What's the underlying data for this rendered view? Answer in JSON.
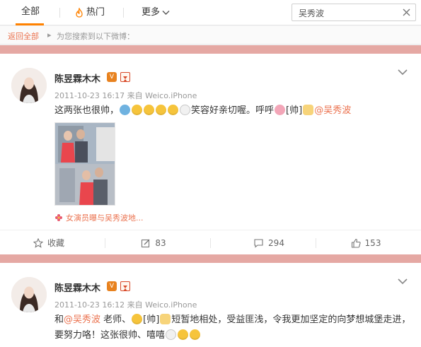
{
  "tabs": {
    "all": "全部",
    "hot": "热门",
    "more": "更多"
  },
  "search": {
    "value": "吴秀波"
  },
  "breadcrumb": {
    "back": "返回全部",
    "separator": "▸",
    "hint": "为您搜索到以下微博："
  },
  "icons": {
    "hot": "flame-icon",
    "more": "chevron-down-icon",
    "clear": "close-icon",
    "collapse": "chevron-down-icon",
    "star": "star-icon",
    "edit": "edit-icon",
    "comment": "comment-icon",
    "like": "thumbs-up-icon"
  },
  "colors": {
    "accent": "#ff8200",
    "link": "#eb7350",
    "separator": "#e5a8a3"
  },
  "posts": [
    {
      "username": "陈昱霖木木",
      "time": "2011-10-23 16:17",
      "source_prefix": "来自",
      "source": "Weico.iPhone",
      "text_a": "这两张也很帅，",
      "text_b": "笑容好亲切喔。呼呼",
      "tag": "[帅]",
      "mention": "@吴秀波",
      "topic": "女演员曝与吴秀波地...",
      "actions": {
        "favorite": "收藏",
        "repost": "83",
        "comment": "294",
        "like": "153"
      }
    },
    {
      "username": "陈昱霖木木",
      "time": "2011-10-23 16:12",
      "source_prefix": "来自",
      "source": "Weico.iPhone",
      "text_pre": "和",
      "mention": "@吴秀波",
      "text_a": " 老师、",
      "tag": "[帅]",
      "text_b": "短暂地相处，受益匪浅，令我更加坚定的向梦想城堡走进，要努力咯！这张很帅、嘻嘻"
    }
  ]
}
